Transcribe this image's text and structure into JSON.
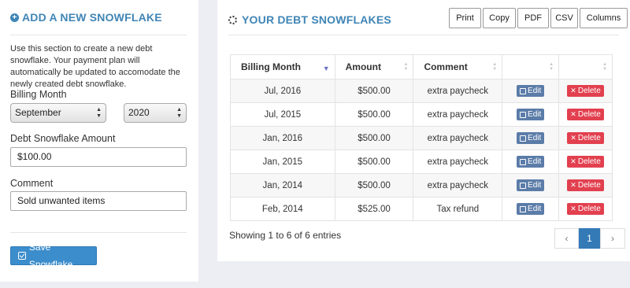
{
  "left": {
    "title": "ADD A NEW SNOWFLAKE",
    "description": "Use this section to create a new debt snowflake. Your payment plan will automatically be updated to accomodate the newly created debt snowflake.",
    "billing_month_label": "Billing Month",
    "month_value": "September",
    "year_value": "2020",
    "amount_label": "Debt Snowflake Amount",
    "amount_value": "$100.00",
    "comment_label": "Comment",
    "comment_value": "Sold unwanted items",
    "save_label": "Save Snowflake"
  },
  "right": {
    "title": "YOUR DEBT SNOWFLAKES",
    "toolbar": [
      "Print",
      "Copy",
      "PDF",
      "CSV",
      "Columns"
    ],
    "columns": [
      "Billing Month",
      "Amount",
      "Comment"
    ],
    "edit_label": "Edit",
    "delete_label": "Delete",
    "rows": [
      {
        "month": "Jul, 2016",
        "amount": "$500.00",
        "comment": "extra paycheck"
      },
      {
        "month": "Jul, 2015",
        "amount": "$500.00",
        "comment": "extra paycheck"
      },
      {
        "month": "Jan, 2016",
        "amount": "$500.00",
        "comment": "extra paycheck"
      },
      {
        "month": "Jan, 2015",
        "amount": "$500.00",
        "comment": "extra paycheck"
      },
      {
        "month": "Jan, 2014",
        "amount": "$500.00",
        "comment": "extra paycheck"
      },
      {
        "month": "Feb, 2014",
        "amount": "$525.00",
        "comment": "Tax refund"
      }
    ],
    "info": "Showing 1 to 6 of 6 entries",
    "pagination": {
      "prev": "‹",
      "current": "1",
      "next": "›"
    }
  },
  "colors": {
    "accent": "#3f85b6",
    "edit": "#5b7ca8",
    "delete": "#e2404f",
    "save": "#3c8dcc"
  }
}
